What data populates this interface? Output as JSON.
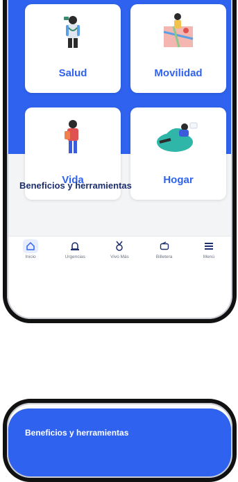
{
  "cards": {
    "salud": "Salud",
    "movilidad": "Movilidad",
    "vida": "Vida",
    "hogar": "Hogar"
  },
  "section": {
    "title": "Beneficios y herramientas"
  },
  "tabbar": {
    "items": [
      {
        "label": "Inicio",
        "icon": "home-icon"
      },
      {
        "label": "Urgencias",
        "icon": "siren-icon"
      },
      {
        "label": "Vivo Más",
        "icon": "medal-icon"
      },
      {
        "label": "Billetera",
        "icon": "wallet-icon"
      },
      {
        "label": "Menú",
        "icon": "menu-icon"
      }
    ]
  },
  "bottom_preview": {
    "title": "Beneficios y herramientas"
  },
  "colors": {
    "brand_blue": "#2f63ef",
    "navy": "#1c2e6b",
    "bg_grey": "#f3f4f6"
  }
}
